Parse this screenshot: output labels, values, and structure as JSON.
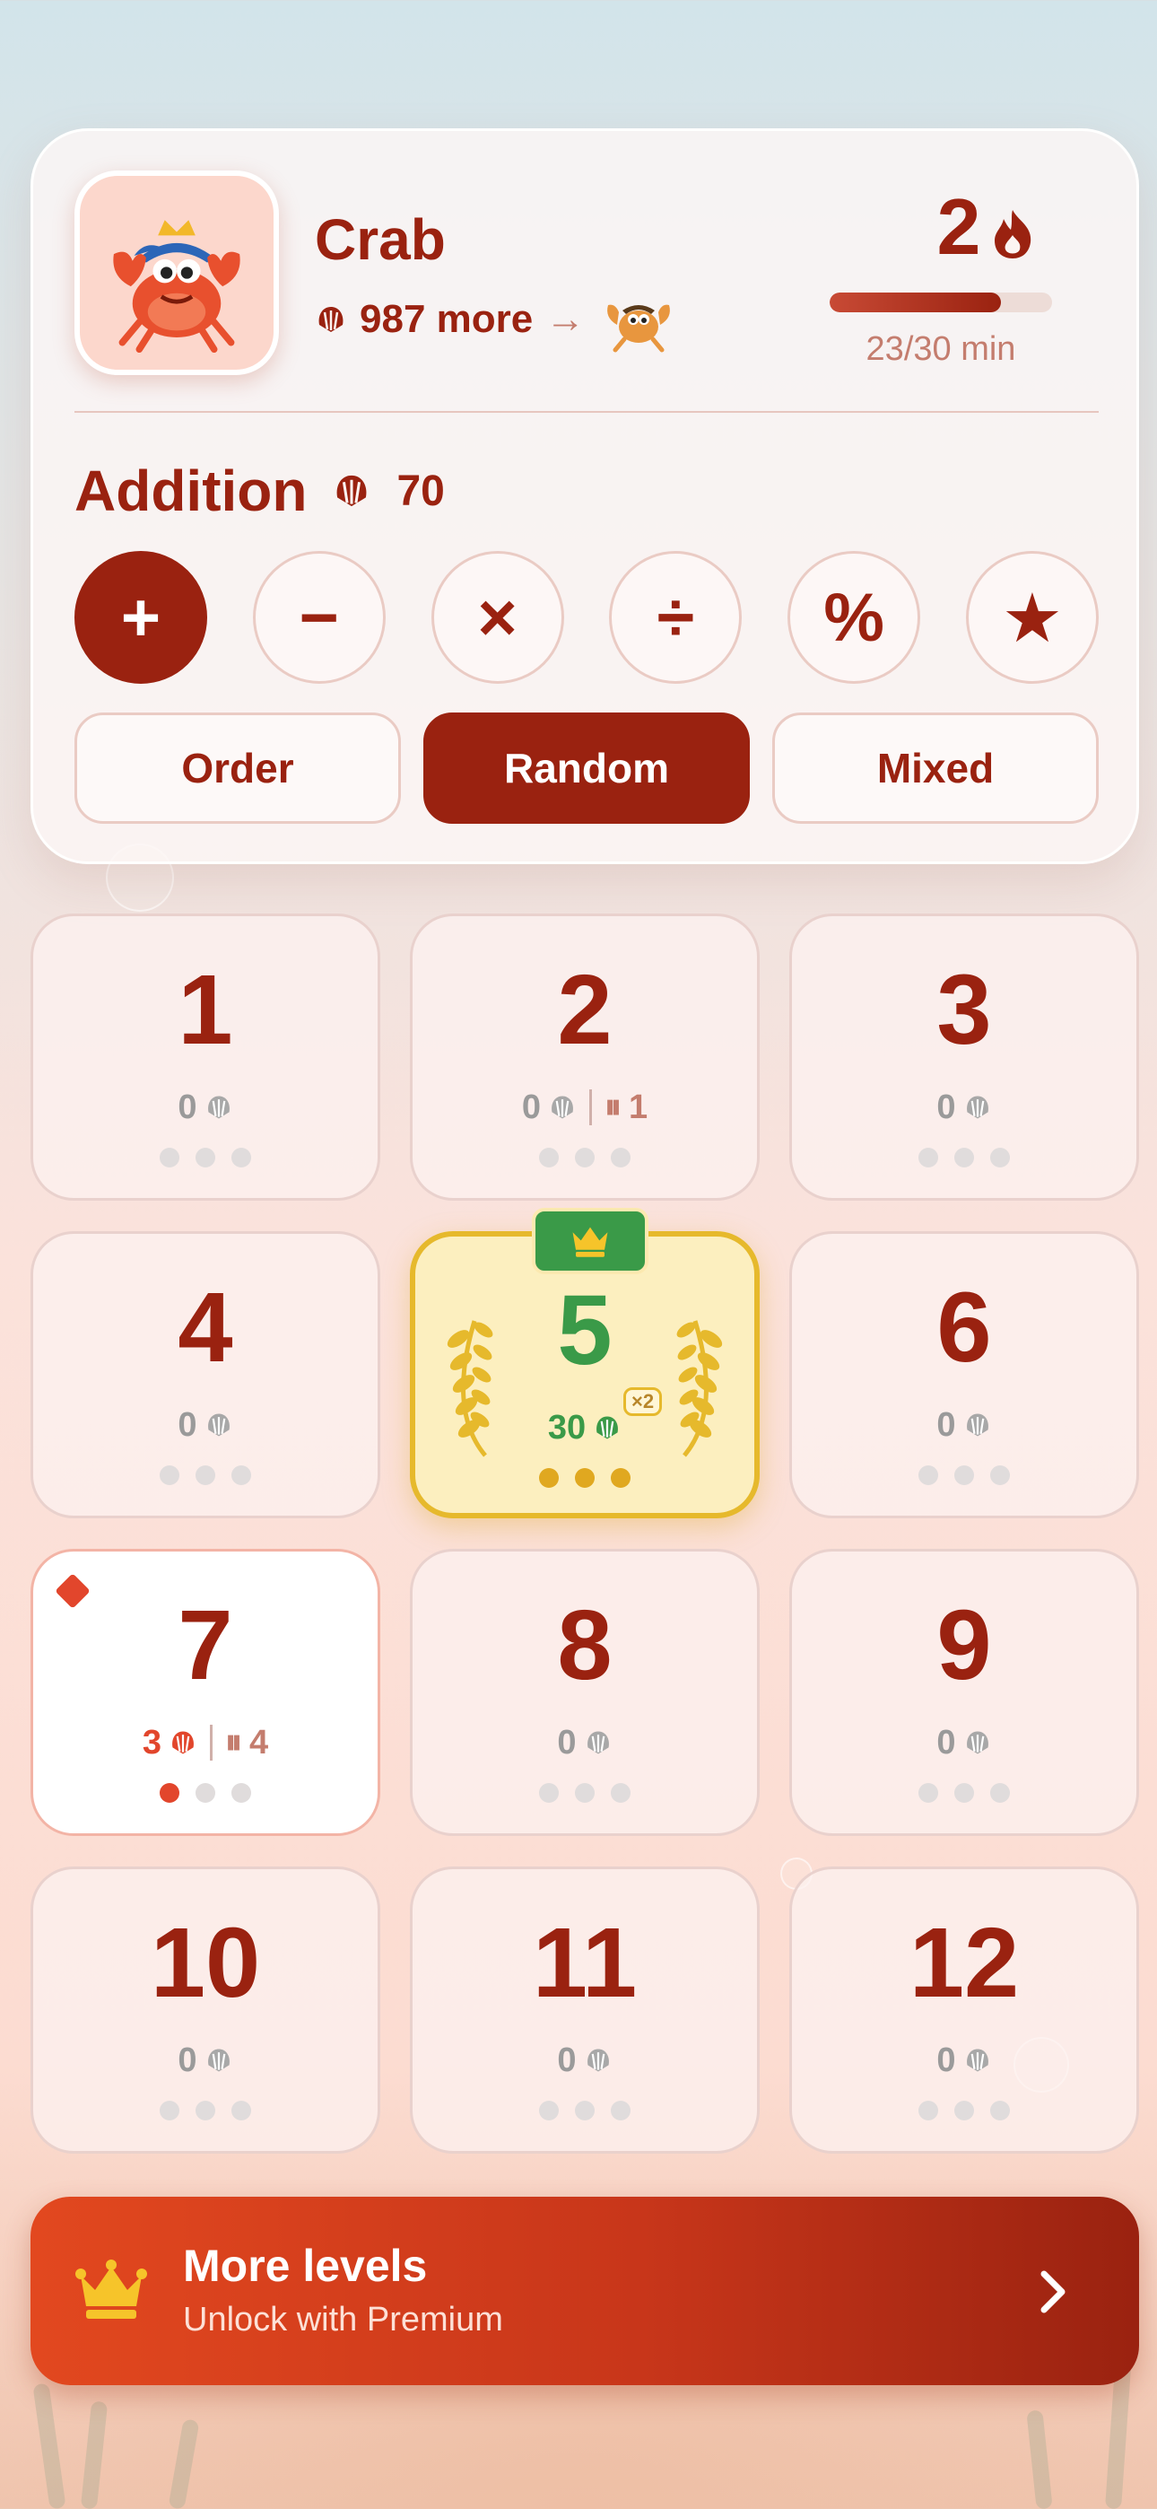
{
  "header": {
    "name": "Crab",
    "shells_more": "987 more",
    "streak": "2",
    "progress_label": "23/30 min",
    "progress_fraction": 0.77
  },
  "operation": {
    "title": "Addition",
    "shell_count": "70",
    "buttons": [
      {
        "label": "+",
        "icon": "plus-icon",
        "active": true
      },
      {
        "label": "−",
        "icon": "minus-icon",
        "active": false
      },
      {
        "label": "×",
        "icon": "multiply-icon",
        "active": false
      },
      {
        "label": "÷",
        "icon": "divide-icon",
        "active": false
      },
      {
        "label": "%",
        "icon": "percent-icon",
        "active": false
      },
      {
        "label": "★",
        "icon": "star-icon",
        "active": false
      }
    ]
  },
  "modes": [
    {
      "label": "Order",
      "active": false
    },
    {
      "label": "Random",
      "active": true
    },
    {
      "label": "Mixed",
      "active": false
    }
  ],
  "levels": [
    {
      "number": "1",
      "shells": "0",
      "paused": ""
    },
    {
      "number": "2",
      "shells": "0",
      "paused": "1"
    },
    {
      "number": "3",
      "shells": "0",
      "paused": ""
    },
    {
      "number": "4",
      "shells": "0",
      "paused": ""
    },
    {
      "number": "5",
      "shells": "30",
      "paused": "",
      "badge": "×2",
      "state": "mastered",
      "stars": 3
    },
    {
      "number": "6",
      "shells": "0",
      "paused": ""
    },
    {
      "number": "7",
      "shells": "3",
      "paused": "4",
      "state": "current",
      "stars": 1
    },
    {
      "number": "8",
      "shells": "0",
      "paused": ""
    },
    {
      "number": "9",
      "shells": "0",
      "paused": ""
    },
    {
      "number": "10",
      "shells": "0",
      "paused": ""
    },
    {
      "number": "11",
      "shells": "0",
      "paused": ""
    },
    {
      "number": "12",
      "shells": "0",
      "paused": ""
    }
  ],
  "premium": {
    "title": "More levels",
    "subtitle": "Unlock with Premium"
  },
  "colors": {
    "primary": "#9a2210",
    "accent": "#e2462c",
    "gold": "#e6b92c",
    "green": "#3a9a48"
  }
}
